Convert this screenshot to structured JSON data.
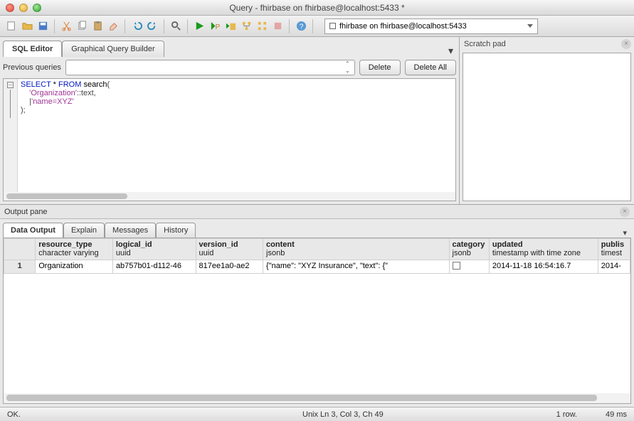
{
  "window": {
    "title": "Query - fhirbase on fhirbase@localhost:5433 *"
  },
  "toolbar": {
    "db": "fhirbase on fhirbase@localhost:5433"
  },
  "editor_tabs": {
    "sql": "SQL Editor",
    "gqb": "Graphical Query Builder"
  },
  "prev": {
    "label": "Previous queries",
    "delete": "Delete",
    "delete_all": "Delete All"
  },
  "sql": {
    "l1a": "SELECT",
    "l1b": " * ",
    "l1c": "FROM",
    "l1d": " search",
    "l2a": "'Organization'",
    "l2b": "::text",
    "l3": "'name=XYZ'",
    "l4": ");"
  },
  "scratch": {
    "title": "Scratch pad"
  },
  "output": {
    "title": "Output pane"
  },
  "out_tabs": {
    "data": "Data Output",
    "explain": "Explain",
    "messages": "Messages",
    "history": "History"
  },
  "cols": {
    "rt": {
      "n": "resource_type",
      "t": "character varying"
    },
    "lid": {
      "n": "logical_id",
      "t": "uuid"
    },
    "vid": {
      "n": "version_id",
      "t": "uuid"
    },
    "con": {
      "n": "content",
      "t": "jsonb"
    },
    "cat": {
      "n": "category",
      "t": "jsonb"
    },
    "upd": {
      "n": "updated",
      "t": "timestamp with time zone"
    },
    "pub": {
      "n": "publis",
      "t": "timest"
    }
  },
  "row": {
    "n": "1",
    "rt": "Organization",
    "lid": "ab757b01-d112-46",
    "vid": "817ee1a0-ae2",
    "con": "{\"name\": \"XYZ Insurance\", \"text\": {\"",
    "upd": "2014-11-18 16:54:16.7",
    "pub": "2014-"
  },
  "status": {
    "ok": "OK.",
    "pos": "Unix     Ln 3, Col 3, Ch 49",
    "rows": "1 row.",
    "time": "49 ms"
  }
}
